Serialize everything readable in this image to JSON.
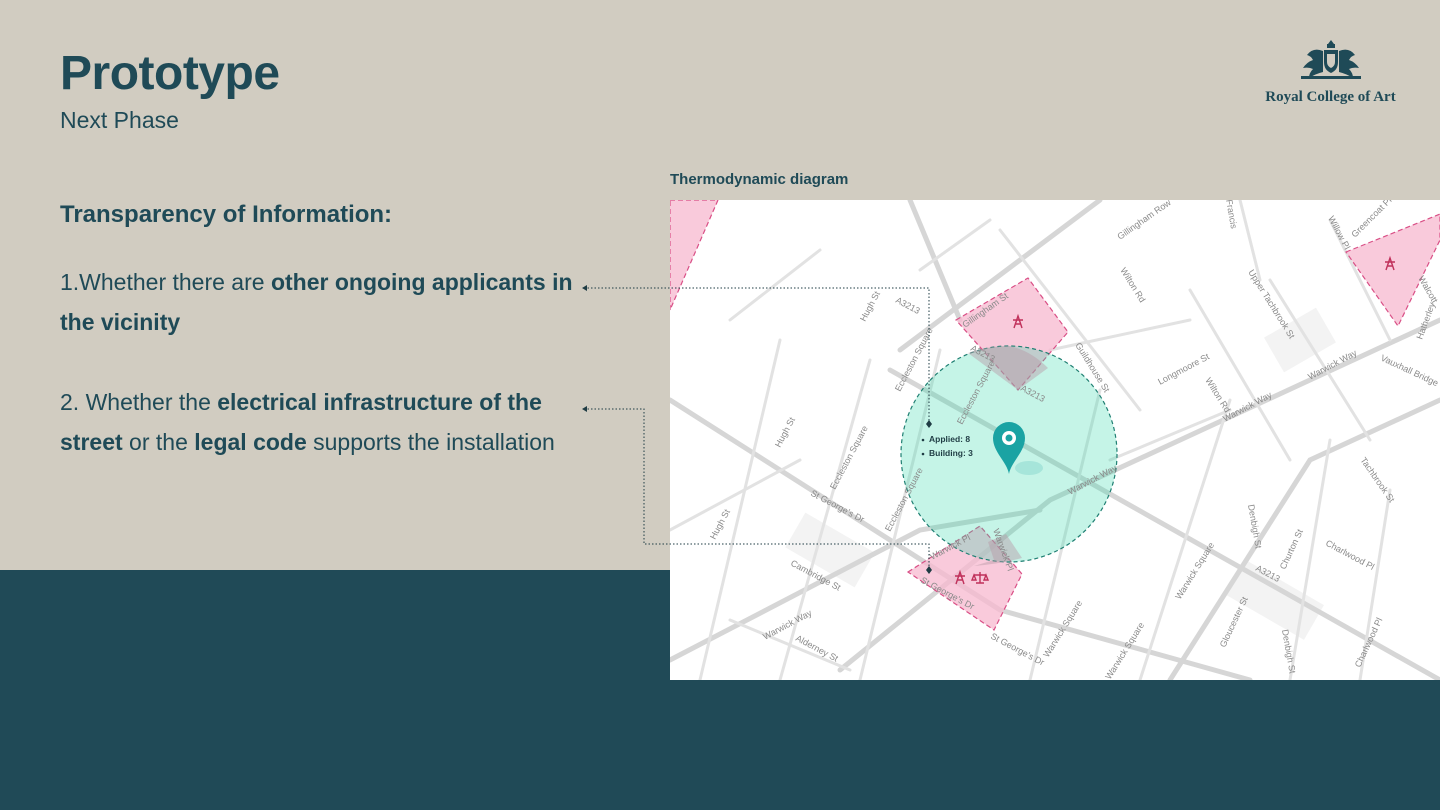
{
  "header": {
    "title": "Prototype",
    "subtitle": "Next Phase"
  },
  "logo": {
    "name": "Royal College of Art",
    "icon": "crest-icon"
  },
  "content": {
    "heading": "Transparency of Information:",
    "point1": {
      "prefix": " 1.Whether there are ",
      "bold": "other ongoing applicants in the vicinity"
    },
    "point2": {
      "prefix": "2. Whether the ",
      "bold1": "electrical infrastructure of the street",
      "middle": " or the ",
      "bold2": "legal code",
      "suffix": " supports the installation"
    }
  },
  "map": {
    "caption": "Thermodynamic diagram",
    "callout": {
      "applied": "Applied: 8",
      "building": "Building: 3"
    },
    "streets": [
      "A3213",
      "A3213",
      "A3213",
      "A3213",
      "Gillingham St",
      "Gillingham Row",
      "Guildhouse St",
      "Wilton Rd",
      "Wilton Rd",
      "Upper Tachbrook St",
      "Longmoore St",
      "Warwick Way",
      "Warwick Way",
      "Warwick Way",
      "Warwick Way",
      "Vauxhall Bridge",
      "Hugh St",
      "Hugh St",
      "Hugh St",
      "Eccleston Square",
      "Eccleston Square",
      "Eccleston Square",
      "Eccleston Square",
      "St George's Dr",
      "St George's Dr",
      "St George's Dr",
      "Cambridge St",
      "Alderney St",
      "Warwick Square",
      "Warwick Square",
      "Warwick Square",
      "Denbigh St",
      "Denbigh St",
      "Tachbrook St",
      "Charlwood Pl",
      "Charlwood Pl",
      "Churton St",
      "Gloucester St",
      "Willow Pl",
      "Greencoat Pl",
      "Hatherley",
      "Walcott",
      "Francis",
      "Warwick Pl",
      "Warwick Pl"
    ],
    "colors": {
      "heat_zone": "#2fd6a8",
      "restricted_zone": "#f7b8cf",
      "pin": "#1aa3a3",
      "accent": "#1f4a57"
    },
    "icons": [
      "map-pin-icon",
      "pylon-icon",
      "pylon-icon",
      "pylon-icon",
      "scales-icon"
    ]
  }
}
